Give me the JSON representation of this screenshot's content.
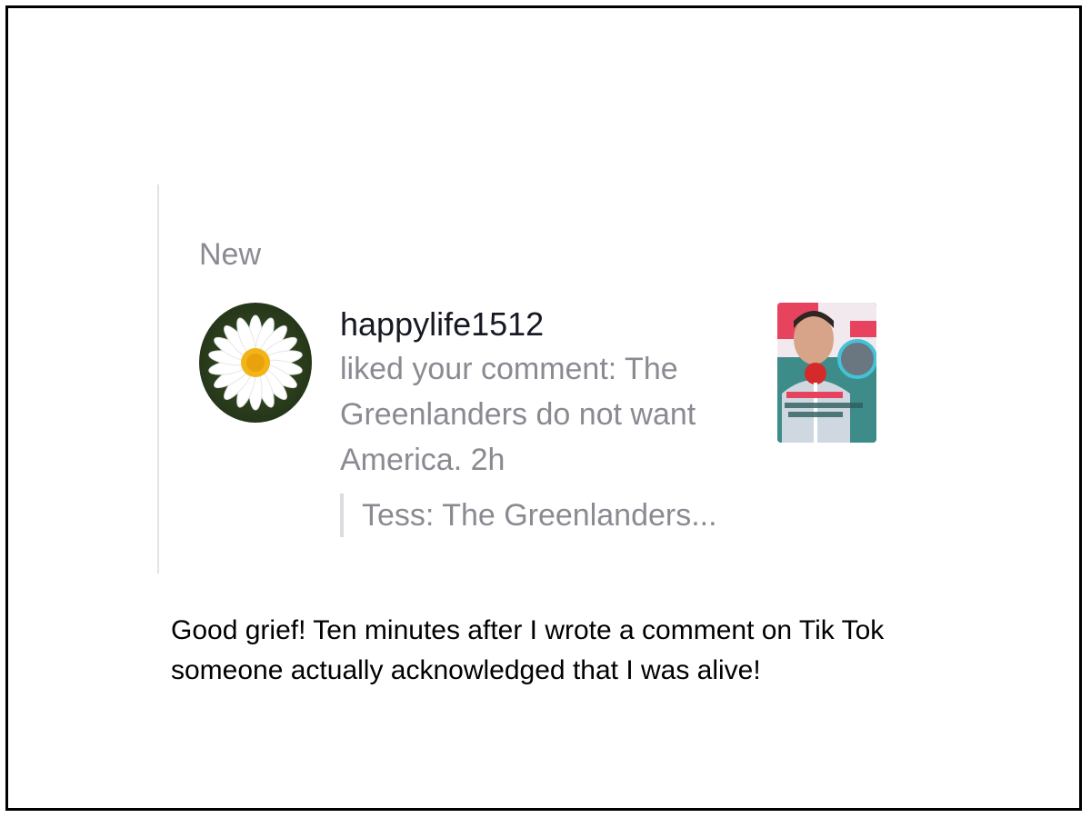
{
  "notifications": {
    "section_label": "New",
    "item": {
      "avatar_icon": "daisy-flower-avatar",
      "username": "happylife1512",
      "message": "liked your comment: The Greenlanders do not want America. 2h",
      "quoted_comment": "Tess: The Greenlanders...",
      "video_thumbnail_icon": "video-thumbnail"
    }
  },
  "caption": "Good grief! Ten minutes after I wrote a comment on Tik Tok someone actually acknowledged that I was alive!",
  "colors": {
    "frame_border": "#000000",
    "muted_text": "#8a8a92",
    "primary_text": "#161823",
    "quote_bar": "#dcdce0"
  }
}
